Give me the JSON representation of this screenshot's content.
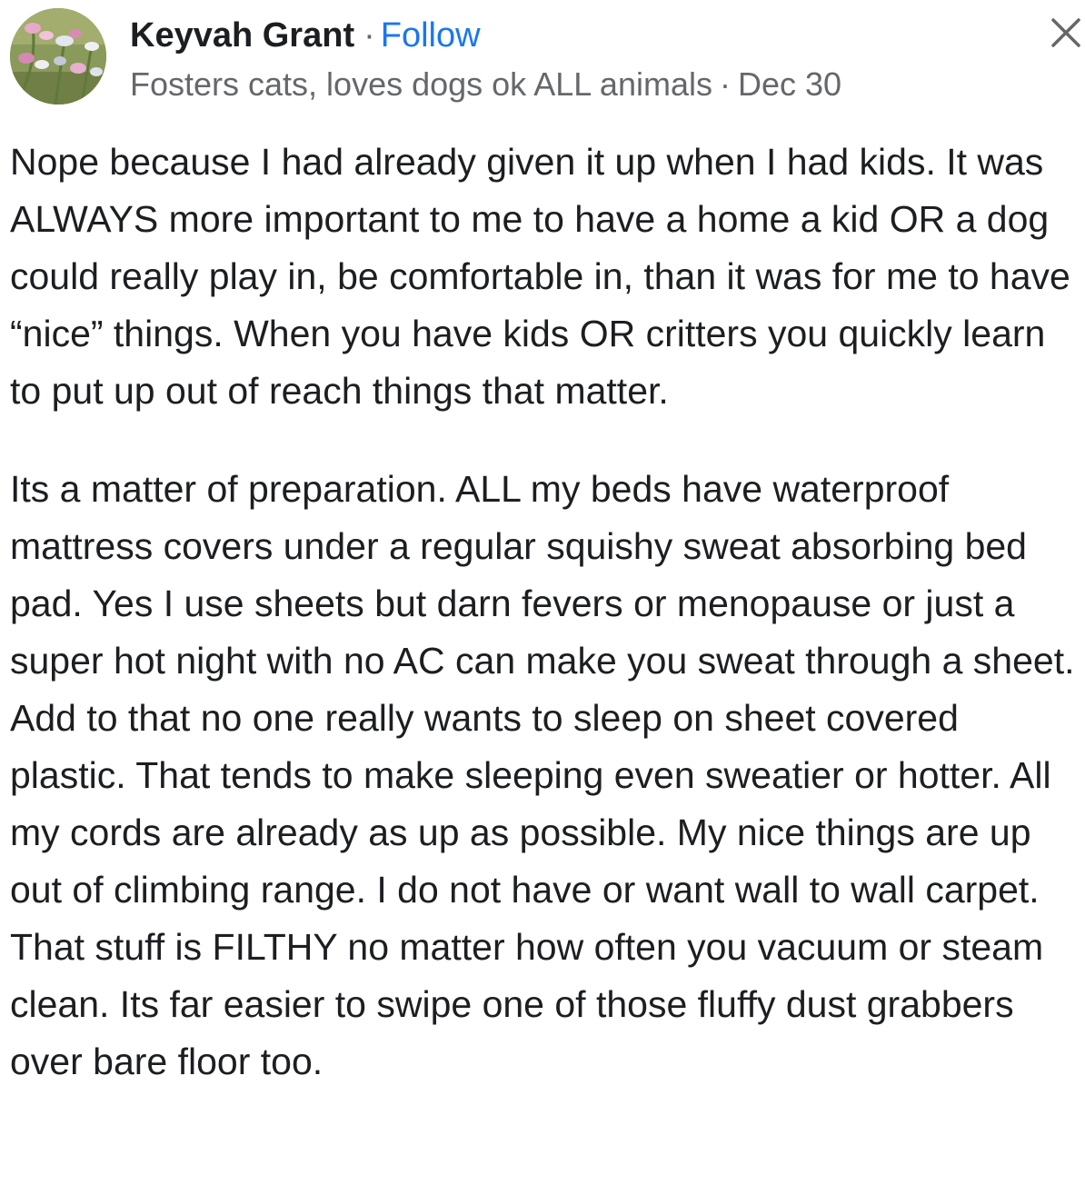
{
  "comment": {
    "author": {
      "name": "Keyvah Grant",
      "follow_label": "Follow",
      "bio": "Fosters cats, loves dogs ok ALL animals",
      "date": "Dec 30"
    },
    "separator": "·",
    "close_icon": "close-icon",
    "paragraphs": [
      "Nope because I had already given it up when I had kids. It was ALWAYS more important to me to have a home a kid OR a dog could really play in, be comfortable in, than it was for me to have “nice” things. When you have kids OR critters you quickly learn to put up out of reach things that matter.",
      "Its a matter of preparation. ALL my beds have waterproof mattress covers under a regular squishy sweat absorbing bed pad. Yes I use sheets but darn fevers or menopause or just a super hot night with no AC can make you sweat through a sheet. Add to that no one really wants to sleep on sheet covered plastic. That tends to make sleeping even sweatier or hotter. All my cords are already as up as possible. My nice things are up out of climbing range. I do not have or want wall to wall carpet. That stuff is FILTHY no matter how often you vacuum or steam clean. Its far easier to swipe one of those fluffy dust grabbers over bare floor too."
    ]
  },
  "colors": {
    "text": "#1c1e21",
    "secondary_text": "#65676b",
    "link": "#1877f2"
  }
}
